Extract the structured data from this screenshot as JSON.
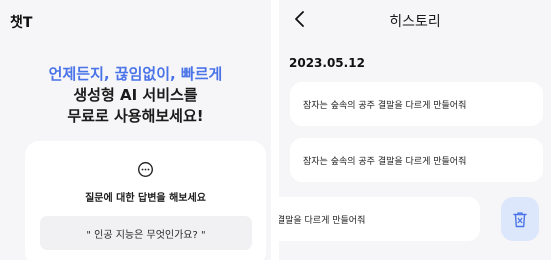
{
  "left_screen": {
    "app_title": "챗T",
    "headline_accent": "언제든지, 끊임없이, 빠르게",
    "headline_line2": "생성형 AI 서비스를",
    "headline_line3": "무료로 사용해보세요!",
    "card": {
      "icon": "chat-bubble-icon",
      "caption": "질문에 대한 답변을 해보세요",
      "example": "\" 인공 지능은 무엇인가요? \""
    }
  },
  "right_screen": {
    "back_icon": "chevron-left-icon",
    "title": "히스토리",
    "date": "2023.05.12",
    "items": [
      {
        "text": "잠자는 숲속의 공주 결말을 다르게 만들어줘"
      },
      {
        "text": "잠자는 숲속의 공주 결말을 다르게 만들어줘"
      },
      {
        "text": "잠자는 숲속의 공주 결말을 다르게 만들어줘"
      }
    ],
    "delete_icon": "trash-icon"
  },
  "colors": {
    "accent": "#4a74e8",
    "background": "#f6f6f8",
    "card": "#ffffff",
    "chip": "#f1f1f4",
    "delete_bg": "#dde7fb",
    "delete_icon": "#4a74e8"
  }
}
